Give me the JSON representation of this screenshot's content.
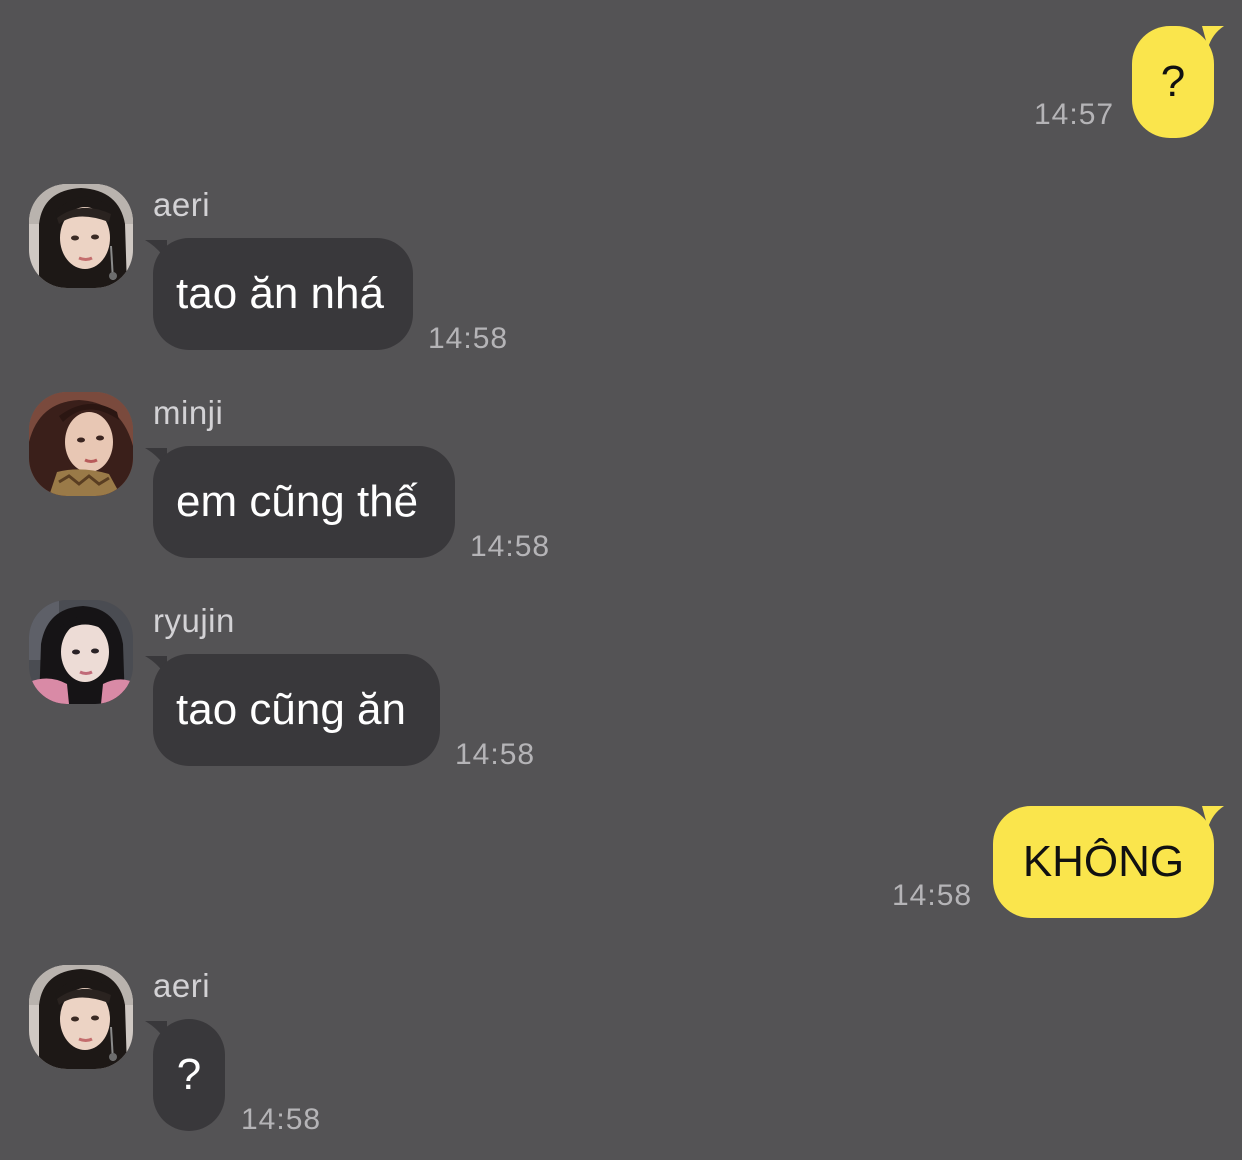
{
  "colors": {
    "background": "#545355",
    "incoming_bubble": "#39383b",
    "outgoing_bubble": "#fae54c",
    "timestamp": "#b5b4b7",
    "sender_name": "#d3d2d5"
  },
  "messages": [
    {
      "direction": "outgoing",
      "text": "?",
      "time": "14:57"
    },
    {
      "direction": "incoming",
      "sender": "aeri",
      "avatar": "avatar-aeri",
      "text": "tao ăn nhá",
      "time": "14:58"
    },
    {
      "direction": "incoming",
      "sender": "minji",
      "avatar": "avatar-minji",
      "text": "em cũng thế",
      "time": "14:58"
    },
    {
      "direction": "incoming",
      "sender": "ryujin",
      "avatar": "avatar-ryujin",
      "text": "tao cũng ăn",
      "time": "14:58"
    },
    {
      "direction": "outgoing",
      "text": "KHÔNG",
      "time": "14:58"
    },
    {
      "direction": "incoming",
      "sender": "aeri",
      "avatar": "avatar-aeri",
      "text": "?",
      "time": "14:58"
    }
  ]
}
